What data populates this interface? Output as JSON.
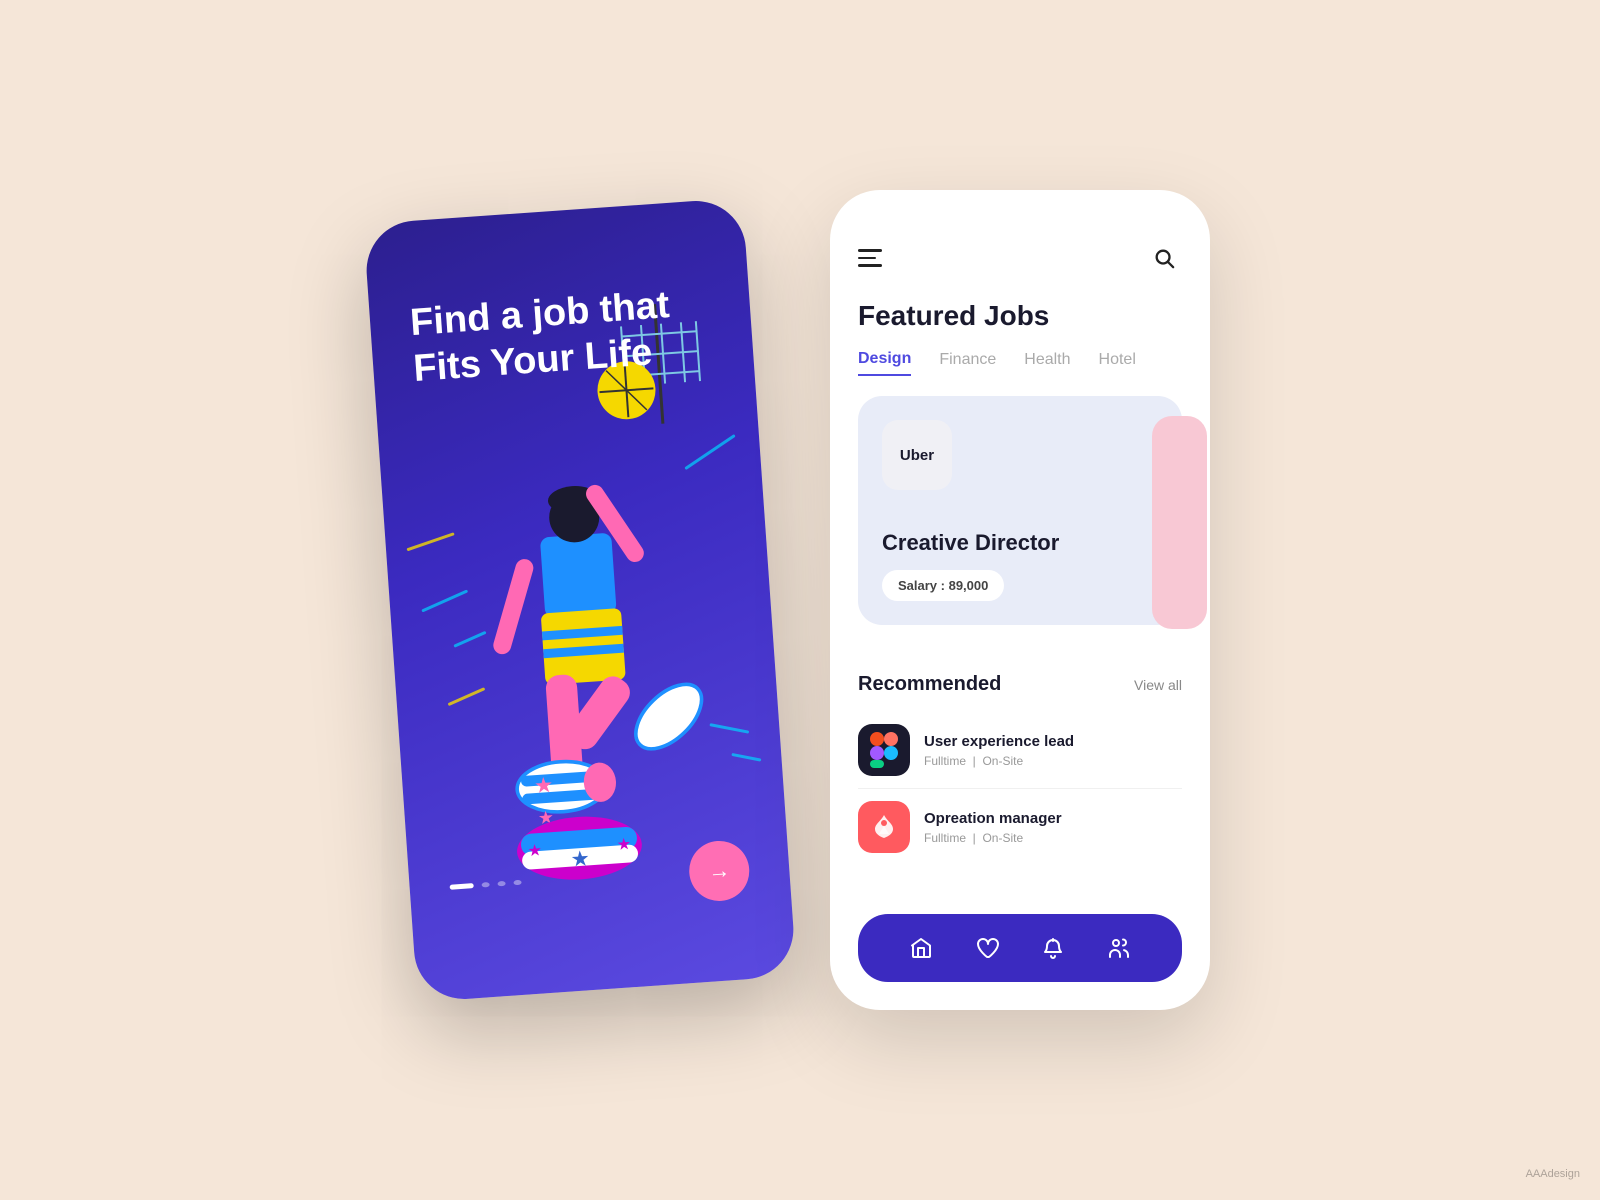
{
  "background_color": "#f5e6d8",
  "left_phone": {
    "headline_line1": "Find a job that",
    "headline_line2": "Fits Your Life",
    "dots": [
      "active",
      "inactive",
      "inactive",
      "inactive"
    ],
    "next_button_icon": "→",
    "gradient_start": "#2c1f8f",
    "gradient_end": "#5b4ae0"
  },
  "right_phone": {
    "title": "Featured Jobs",
    "categories": [
      {
        "label": "Design",
        "active": true
      },
      {
        "label": "Finance",
        "active": false
      },
      {
        "label": "Health",
        "active": false
      },
      {
        "label": "Hotel",
        "active": false
      }
    ],
    "featured_job": {
      "company": "Uber",
      "job_title": "Creative Director",
      "salary_label": "Salary : 89,000"
    },
    "recommended_section": {
      "title": "Recommended",
      "view_all": "View all",
      "jobs": [
        {
          "company_icon_type": "figma",
          "title": "User experience lead",
          "type": "Fulltime",
          "mode": "On-Site"
        },
        {
          "company_icon_type": "airbnb",
          "title": "Opreation manager",
          "type": "Fulltime",
          "mode": "On-Site"
        }
      ]
    },
    "nav_items": [
      {
        "icon": "home",
        "label": "Home"
      },
      {
        "icon": "heart",
        "label": "Favorites"
      },
      {
        "icon": "bell",
        "label": "Notifications"
      },
      {
        "icon": "people",
        "label": "Profile"
      }
    ]
  }
}
